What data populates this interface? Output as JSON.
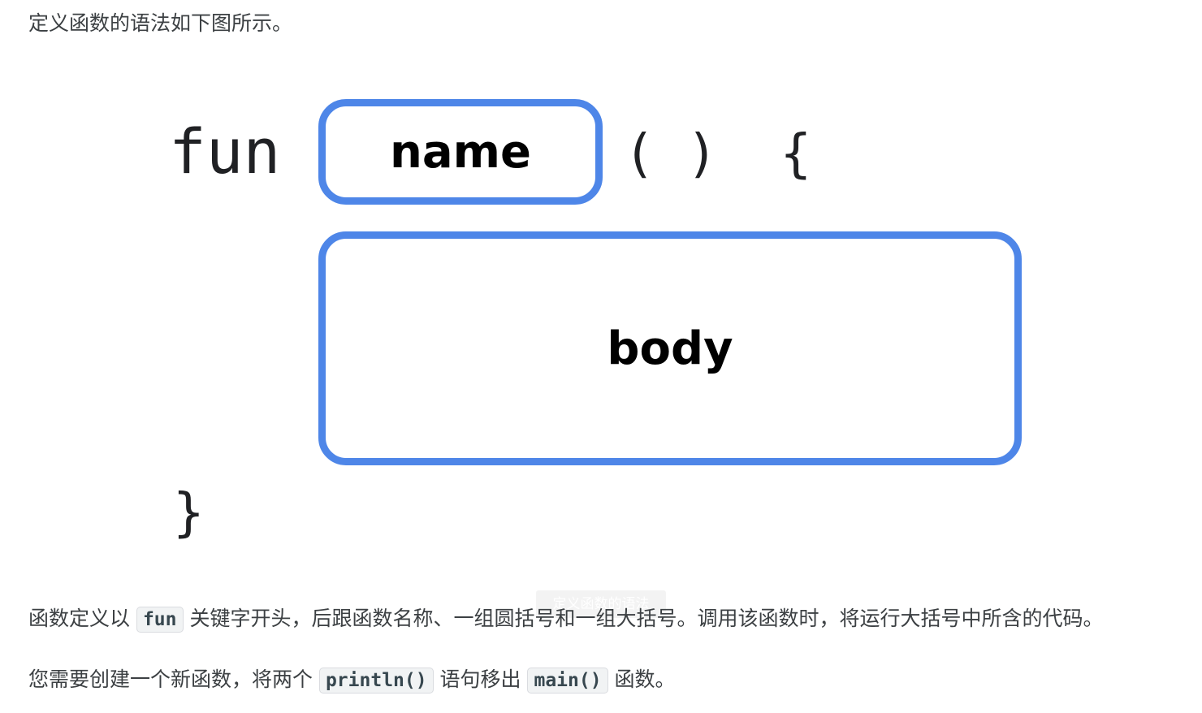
{
  "intro": "定义函数的语法如下图所示。",
  "figure": {
    "keyword": "fun",
    "name_label": "name",
    "parens_brace": "( )  {",
    "body_label": "body",
    "close_brace": "}",
    "caption": "定义函数的语法"
  },
  "para1": {
    "before": "函数定义以 ",
    "code": "fun",
    "after": " 关键字开头，后跟函数名称、一组圆括号和一组大括号。调用该函数时，将运行大括号中所含的代码。"
  },
  "para2": {
    "before": "您需要创建一个新函数，将两个 ",
    "code1": "println()",
    "middle": " 语句移出 ",
    "code2": "main()",
    "after": " 函数。"
  }
}
